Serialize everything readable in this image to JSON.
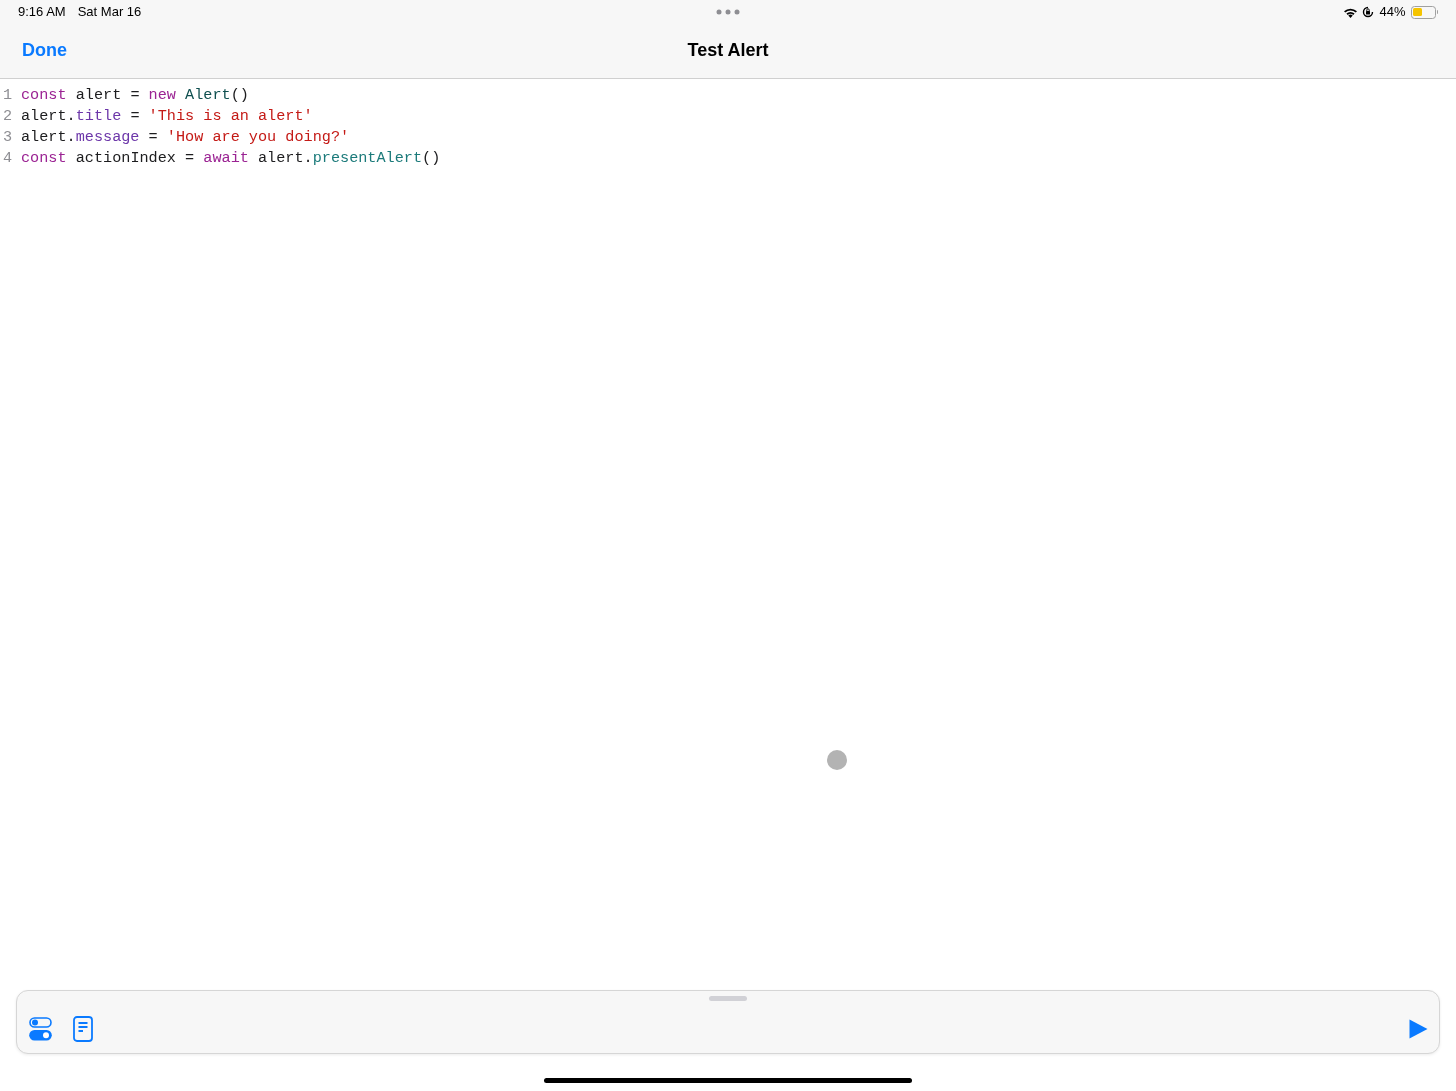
{
  "status_bar": {
    "time": "9:16 AM",
    "date": "Sat Mar 16",
    "battery_percent": "44%",
    "battery": {
      "level": 0.44
    }
  },
  "nav_bar": {
    "done": "Done",
    "title": "Test Alert"
  },
  "code": [
    {
      "number": "1",
      "tokens": [
        {
          "kind": "keyword",
          "text": "const"
        },
        {
          "kind": "plain",
          "text": " alert = "
        },
        {
          "kind": "keyword",
          "text": "new"
        },
        {
          "kind": "class",
          "text": " Alert"
        },
        {
          "kind": "plain",
          "text": "()"
        }
      ]
    },
    {
      "number": "2",
      "tokens": [
        {
          "kind": "plain",
          "text": "alert."
        },
        {
          "kind": "property",
          "text": "title"
        },
        {
          "kind": "plain",
          "text": " = "
        },
        {
          "kind": "string",
          "text": "'This is an alert'"
        }
      ]
    },
    {
      "number": "3",
      "tokens": [
        {
          "kind": "plain",
          "text": "alert."
        },
        {
          "kind": "property",
          "text": "message"
        },
        {
          "kind": "plain",
          "text": " = "
        },
        {
          "kind": "string",
          "text": "'How are you doing?'"
        }
      ]
    },
    {
      "number": "4",
      "tokens": [
        {
          "kind": "keyword",
          "text": "const"
        },
        {
          "kind": "plain",
          "text": " actionIndex = "
        },
        {
          "kind": "keyword",
          "text": "await"
        },
        {
          "kind": "plain",
          "text": " alert."
        },
        {
          "kind": "method",
          "text": "presentAlert"
        },
        {
          "kind": "plain",
          "text": "()"
        }
      ]
    }
  ]
}
